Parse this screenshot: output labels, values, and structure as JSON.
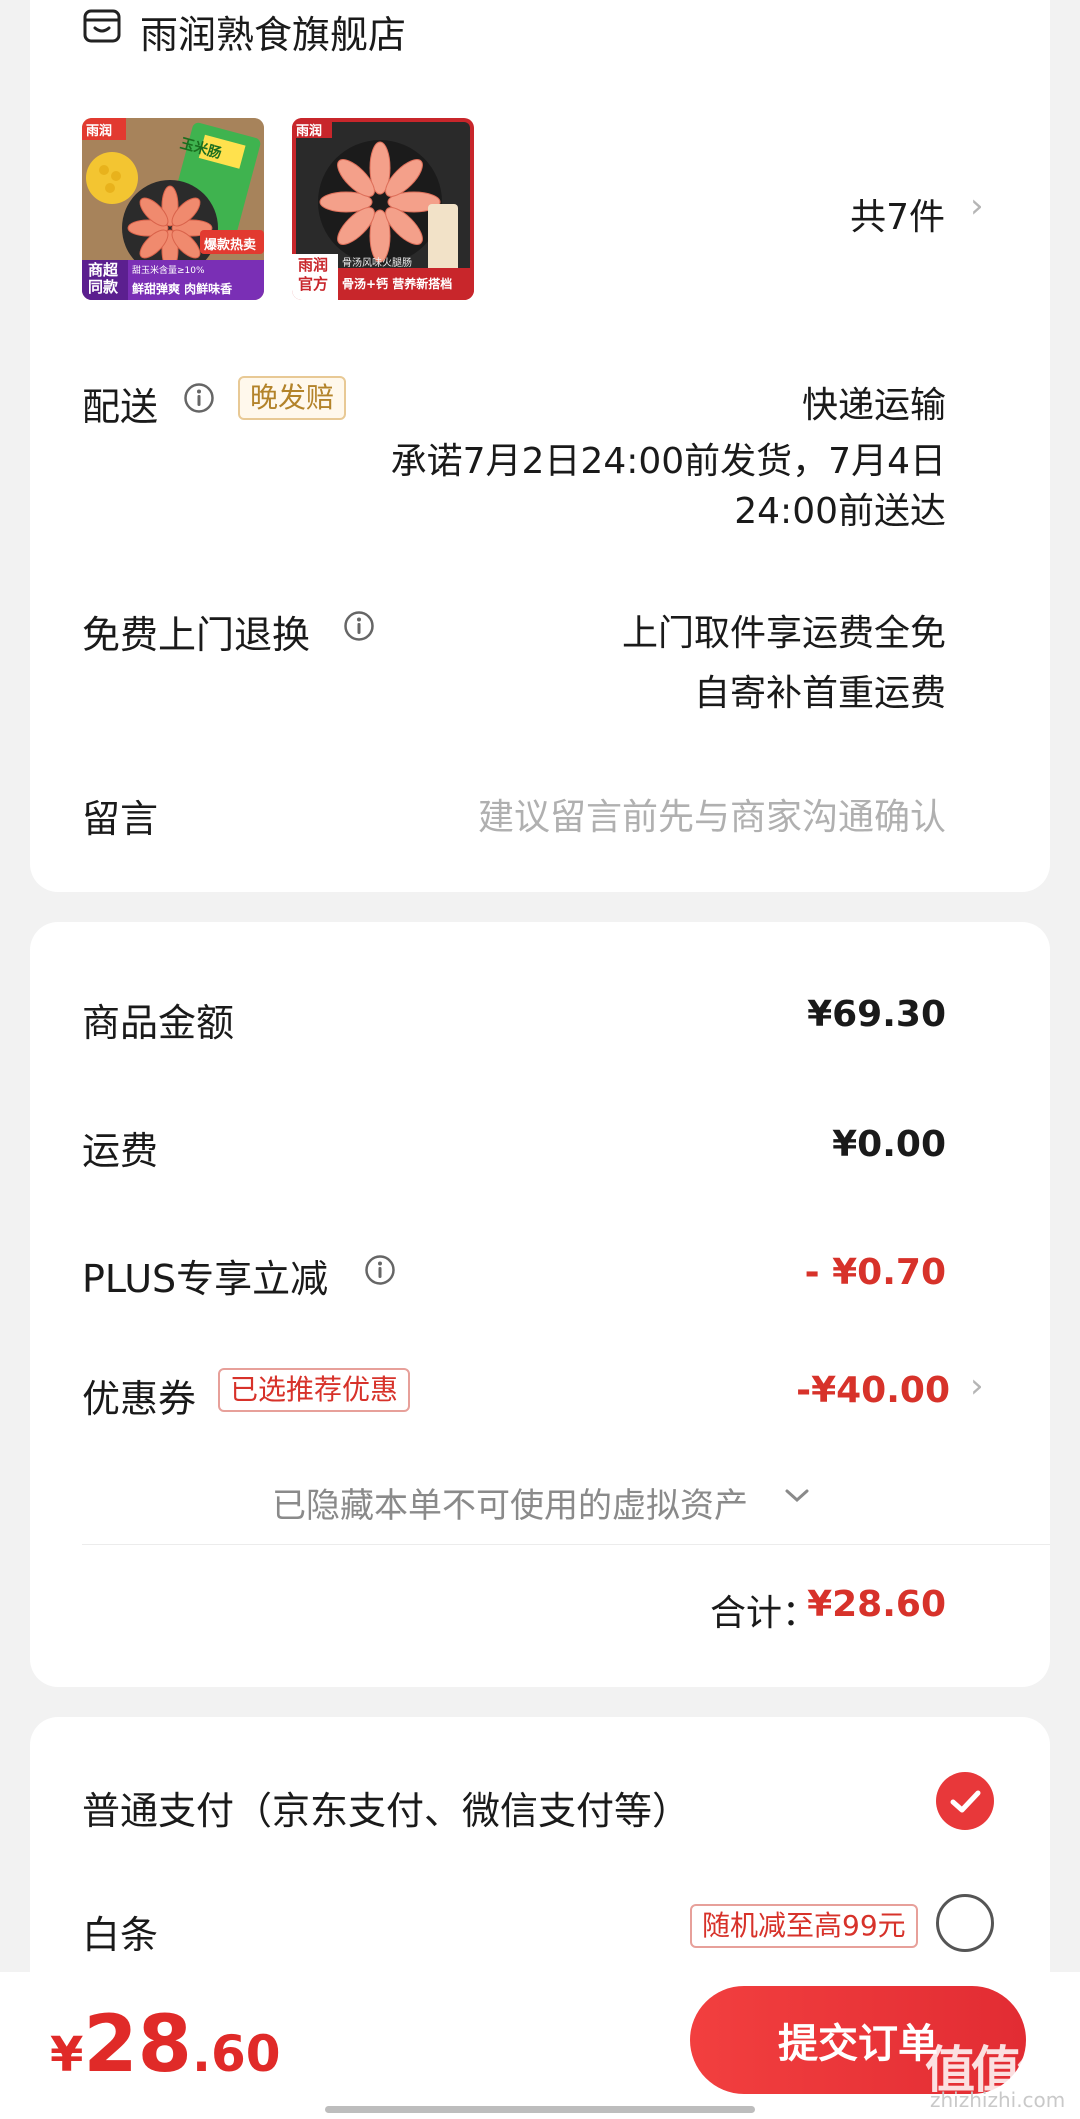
{
  "store": {
    "name": "雨润熟食旗舰店",
    "icon": "store-icon"
  },
  "products": {
    "thumb1": {
      "brand": "雨润",
      "badge_hot": "爆款热卖",
      "badge_tl": "商超",
      "badge_bl": "同款",
      "note": "甜玉米含量≥10%",
      "caption": "鲜甜弹爽 肉鲜味香",
      "pack": "玉米肠"
    },
    "thumb2": {
      "brand": "雨润",
      "badge_tl": "雨润",
      "badge_bl": "官方",
      "top_caption": "骨汤风味火腿肠",
      "caption": "骨汤+钙 营养新搭档"
    },
    "count": "共7件"
  },
  "delivery": {
    "label": "配送",
    "tag": "晚发赔",
    "method": "快递运输",
    "line1": "承诺7月2日24:00前发货，7月4日",
    "line2": "24:00前送达"
  },
  "returns": {
    "label": "免费上门退换",
    "line1": "上门取件享运费全免",
    "line2": "自寄补首重运费"
  },
  "message": {
    "label": "留言",
    "placeholder": "建议留言前先与商家沟通确认"
  },
  "summary": {
    "goods_label": "商品金额",
    "goods_value": "¥69.30",
    "shipping_label": "运费",
    "shipping_value": "¥0.00",
    "plus_label": "PLUS专享立减",
    "plus_value": "- ¥0.70",
    "coupon_label": "优惠券",
    "coupon_tag": "已选推荐优惠",
    "coupon_value": "-¥40.00",
    "hidden_assets": "已隐藏本单不可使用的虚拟资产",
    "total_label": "合计：",
    "total_value": "¥28.60"
  },
  "payment": {
    "normal": "普通支付（京东支付、微信支付等）",
    "baitiao": "白条",
    "baitiao_tag": "随机减至高99元"
  },
  "bottom": {
    "currency": "¥",
    "price_int": "28",
    "price_dec": ".60",
    "submit": "提交订单",
    "watermark": "值值值",
    "watermark_site": "zhizhizhi.com"
  },
  "colors": {
    "accent_red": "#e02a28",
    "tag_gold": "#b3832a"
  }
}
